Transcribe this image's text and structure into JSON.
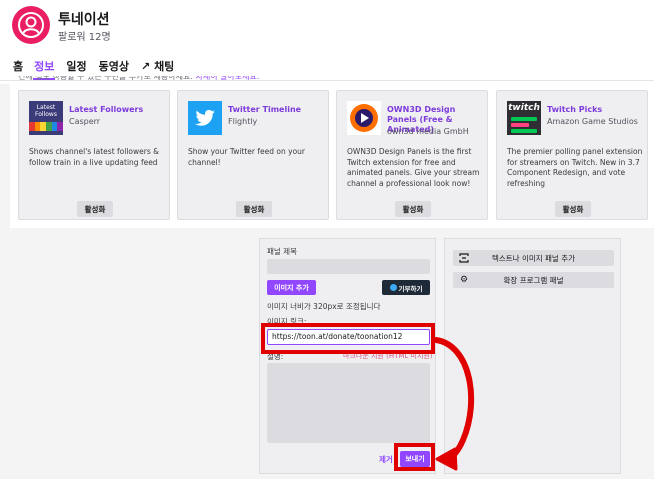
{
  "channel": {
    "name": "투네이션",
    "followers": "팔로워 12명"
  },
  "nav": {
    "items": [
      "홈",
      "정보",
      "일정",
      "동영상",
      "채팅"
    ],
    "active": "정보"
  },
  "notice": {
    "text": "건에 정보 작동할 수 있는 수단을 추가로 제공하세요.",
    "link": "자세히 알아보세요."
  },
  "extensions": [
    {
      "title": "Latest Followers",
      "author": "Casperr",
      "description": "Shows channel's latest followers & follow train in a live updating feed",
      "button": "활성화",
      "icon": "latest-follows-icon",
      "icon_text": "Latest Follows"
    },
    {
      "title": "Twitter Timeline",
      "author": "Flightly",
      "description": "Show your Twitter feed on your channel!",
      "button": "활성화",
      "icon": "twitter-bird-icon"
    },
    {
      "title": "OWN3D Design Panels (Free & Animated)",
      "author": "own3d media GmbH",
      "description": "OWN3D Design Panels is the first Twitch extension for free and animated panels. Give your stream channel a professional look now!",
      "button": "활성화",
      "icon": "own3d-icon"
    },
    {
      "title": "Twitch Picks",
      "author": "Amazon Game Studios",
      "description": "The premier polling panel extension for streamers on Twitch. New in 3.7 Component Redesign, and vote refreshing",
      "button": "활성화",
      "icon": "twitch-picks-icon",
      "icon_text": "twitch"
    }
  ],
  "editor": {
    "title_label": "패널 제목",
    "image_add_button": "이미지 추가",
    "donate_badge": "기부하기",
    "width_note": "이미지 너비가 320px로 조정됩니다",
    "link_label": "이미지 링크:",
    "link_value": "https://toon.at/donate/toonation12",
    "desc_label": "설명:",
    "desc_hint": "마크다운 지원 (HTML 미지원)",
    "remove_label": "제거",
    "submit_label": "보내기"
  },
  "side_panel": {
    "add_text_image_panel": "텍스트나 이미지 패널 추가",
    "extension_panel": "확장 프로그램 패널"
  },
  "colors": {
    "accent": "#9147ff",
    "highlight": "#e00000"
  }
}
